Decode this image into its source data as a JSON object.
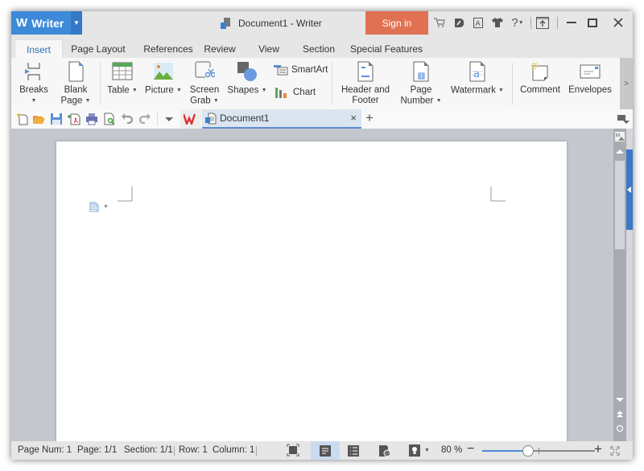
{
  "app": {
    "name": "Writer",
    "logo": "W",
    "window_title": "Document1 - Writer",
    "sign_in": "Sign in",
    "brand_color": "#3c8ad8",
    "signin_color": "#e07152"
  },
  "title_icons": [
    "cart-icon",
    "skin-icon",
    "font-icon",
    "tshirt-icon",
    "help-icon",
    "upload-icon"
  ],
  "tabs": [
    {
      "label": "Insert",
      "active": true
    },
    {
      "label": "Page Layout"
    },
    {
      "label": "References"
    },
    {
      "label": "Review"
    },
    {
      "label": "View"
    },
    {
      "label": "Section"
    },
    {
      "label": "Special Features"
    }
  ],
  "ribbon": {
    "breaks": "Breaks",
    "blank_page_1": "Blank",
    "blank_page_2": "Page",
    "table": "Table",
    "picture": "Picture",
    "screen_grab_1": "Screen",
    "screen_grab_2": "Grab",
    "shapes": "Shapes",
    "smartart": "SmartArt",
    "chart": "Chart",
    "header_footer_1": "Header and",
    "header_footer_2": "Footer",
    "page_number_1": "Page",
    "page_number_2": "Number",
    "watermark": "Watermark",
    "comment": "Comment",
    "envelopes": "Envelopes",
    "more": ">"
  },
  "doc_tab": {
    "label": "Document1",
    "close": "×",
    "new": "+"
  },
  "status": {
    "page_num": "Page Num: 1",
    "page": "Page: 1/1",
    "section": "Section: 1/1",
    "row": "Row: 1",
    "column": "Column: 1",
    "zoom": "80 %",
    "zoom_minus": "−",
    "zoom_plus": "+",
    "zoom_fraction": 0.4
  }
}
